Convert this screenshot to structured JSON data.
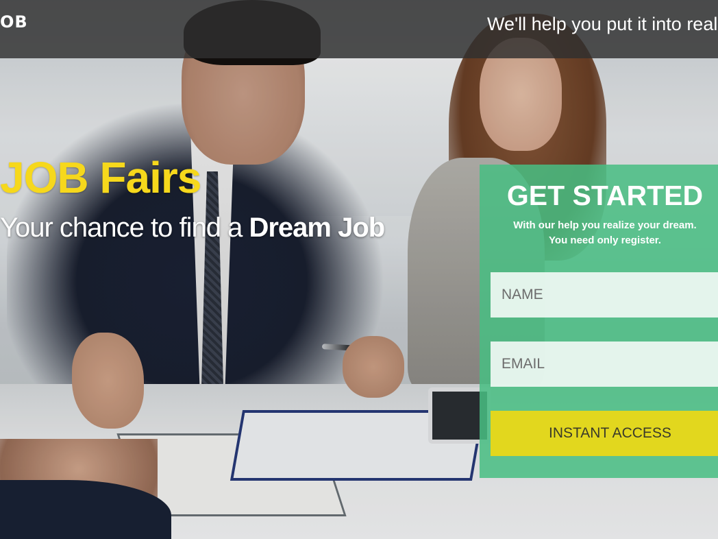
{
  "header": {
    "logo": "OB",
    "tagline": "We'll help you put it into reali"
  },
  "hero": {
    "title": "JOB Fairs",
    "subtitle_prefix": "Your chance to find a ",
    "subtitle_bold": "Dream Job"
  },
  "signup": {
    "title": "GET STARTED",
    "subtitle_line1": "With our help you realize your dream.",
    "subtitle_line2": "You need only register.",
    "name_placeholder": "NAME",
    "email_placeholder": "EMAIL",
    "button_label": "INSTANT ACCESS"
  },
  "colors": {
    "accent_yellow": "#f6d81c",
    "panel_green": "#48be82",
    "button_yellow": "#e2d71e"
  }
}
